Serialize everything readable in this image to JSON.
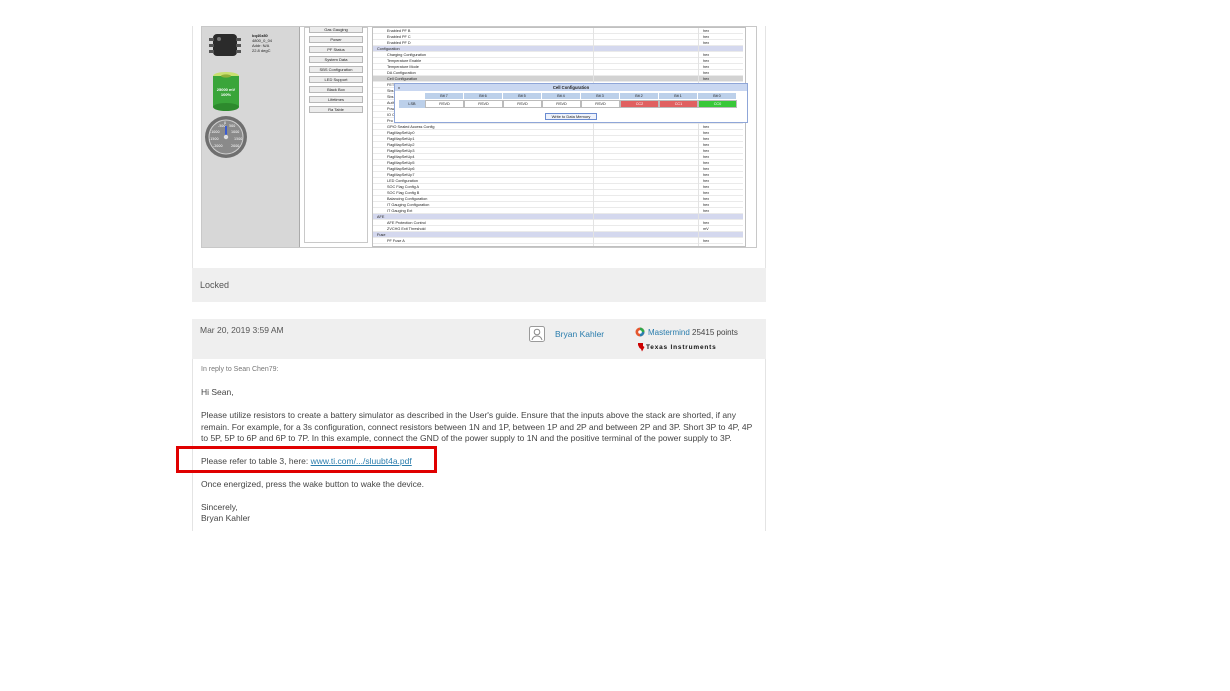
{
  "embedded_screenshot": {
    "device": {
      "name": "bq40z80",
      "fw": "4800_0_04",
      "addr": "Addr: N/A",
      "temp": "22.8 degC"
    },
    "battery": {
      "voltage": "25000 mV",
      "percent": "100%"
    },
    "gauge_ticks": [
      "-500",
      "500",
      "1000",
      "-1000",
      "-1500",
      "1500",
      "-2000",
      "2000",
      "0"
    ],
    "nav_buttons": [
      "Gas Gauging",
      "Power",
      "PF Status",
      "System Data",
      "SBS Configuration",
      "LED Support",
      "Black Box",
      "Lifetimes",
      "Ra Table"
    ],
    "grid_rows": [
      {
        "name": "Enabled PF B",
        "value": "hex",
        "type": "row"
      },
      {
        "name": "Enabled PF C",
        "value": "hex",
        "type": "row"
      },
      {
        "name": "Enabled PF D",
        "value": "hex",
        "type": "row"
      },
      {
        "name": "Configuration",
        "value": "",
        "type": "section"
      },
      {
        "name": "Charging Configuration",
        "value": "hex",
        "type": "row"
      },
      {
        "name": "Temperature Enable",
        "value": "hex",
        "type": "row"
      },
      {
        "name": "Temperature Mode",
        "value": "hex",
        "type": "row"
      },
      {
        "name": "DA Configuration",
        "value": "hex",
        "type": "row"
      },
      {
        "name": "Cell Configuration",
        "value": "hex",
        "type": "selected"
      },
      {
        "name": "FET",
        "value": "hex",
        "type": "row"
      },
      {
        "name": "Sbs",
        "value": "hex",
        "type": "row"
      },
      {
        "name": "Sbs",
        "value": "hex",
        "type": "row"
      },
      {
        "name": "Auth",
        "value": "hex",
        "type": "row"
      },
      {
        "name": "Pow",
        "value": "hex",
        "type": "row"
      },
      {
        "name": "IO C",
        "value": "hex",
        "type": "row"
      },
      {
        "name": "Pro",
        "value": "hex",
        "type": "row"
      },
      {
        "name": "GPIO Sealed Access Config",
        "value": "hex",
        "type": "row"
      },
      {
        "name": "FlagMapSetUp0",
        "value": "hex",
        "type": "row"
      },
      {
        "name": "FlagMapSetUp1",
        "value": "hex",
        "type": "row"
      },
      {
        "name": "FlagMapSetUp2",
        "value": "hex",
        "type": "row"
      },
      {
        "name": "FlagMapSetUp3",
        "value": "hex",
        "type": "row"
      },
      {
        "name": "FlagMapSetUp4",
        "value": "hex",
        "type": "row"
      },
      {
        "name": "FlagMapSetUp5",
        "value": "hex",
        "type": "row"
      },
      {
        "name": "FlagMapSetUp6",
        "value": "hex",
        "type": "row"
      },
      {
        "name": "FlagMapSetUp7",
        "value": "hex",
        "type": "row"
      },
      {
        "name": "LED Configuration",
        "value": "hex",
        "type": "row"
      },
      {
        "name": "SOC Flag Config A",
        "value": "hex",
        "type": "row"
      },
      {
        "name": "SOC Flag Config B",
        "value": "hex",
        "type": "row"
      },
      {
        "name": "Balancing Configuration",
        "value": "hex",
        "type": "row"
      },
      {
        "name": "IT Gauging Configuration",
        "value": "hex",
        "type": "row"
      },
      {
        "name": "IT Gauging Ext",
        "value": "hex",
        "type": "row"
      },
      {
        "name": "AFE",
        "value": "",
        "type": "section"
      },
      {
        "name": "AFE Protection Control",
        "value": "hex",
        "type": "row"
      },
      {
        "name": "ZVCHG Exit Threshold",
        "value": "mV",
        "type": "row"
      },
      {
        "name": "Fuse",
        "value": "",
        "type": "section"
      },
      {
        "name": "PF Fuse A",
        "value": "hex",
        "type": "row"
      }
    ],
    "cell_config": {
      "title": "Cell Configuration",
      "close": "x",
      "row_label": "LSB",
      "bit_headers": [
        "Bit 7",
        "Bit 6",
        "Bit 5",
        "Bit 4",
        "Bit 3",
        "Bit 2",
        "Bit 1",
        "Bit 0"
      ],
      "bit_values": [
        "RSVD",
        "RSVD",
        "RSVD",
        "RSVD",
        "RSVD",
        "CC2",
        "CC1",
        "CC0"
      ],
      "bit_states": [
        "off",
        "off",
        "off",
        "off",
        "off",
        "red",
        "red",
        "green"
      ],
      "write_button": "Write to Data Memory"
    }
  },
  "post_top": {
    "status": "Locked"
  },
  "reply": {
    "date": "Mar 20, 2019 3:59 AM",
    "author": "Bryan Kahler",
    "rank": "Mastermind",
    "points": "25415 points",
    "company": "Texas Instruments",
    "in_reply_to": "In reply to Sean Chen79:",
    "greeting": "Hi Sean,",
    "paragraph1": "Please utilize resistors to create a battery simulator as described in the User's guide. Ensure that the inputs above the stack are shorted, if any remain. For example, for a 3s configuration, connect resistors between 1N and 1P, between 1P and 2P and between 2P and 3P. Short 3P to 4P, 4P to 5P, 5P to 6P and 6P to 7P. In this example, connect the GND of the power supply to 1N and the positive terminal of the power supply to 3P.",
    "refer_prefix": "Please refer to table 3, here: ",
    "refer_link": "www.ti.com/.../sluubt4a.pdf",
    "paragraph3": "Once energized, press the wake button to wake the device.",
    "closing": "Sincerely,",
    "signature": "Bryan Kahler"
  },
  "colors": {
    "link": "#2a7dad",
    "highlight_box": "#e00000",
    "card_bg": "#efefef"
  }
}
